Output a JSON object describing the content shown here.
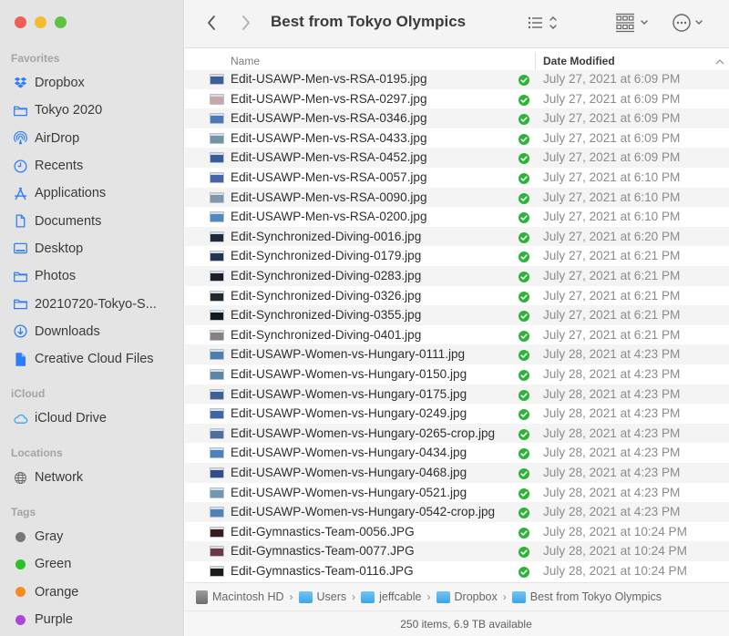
{
  "window": {
    "title": "Best from Tokyo Olympics"
  },
  "sidebar": {
    "sections": [
      {
        "heading": "Favorites",
        "items": [
          {
            "label": "Dropbox",
            "icon": "dropbox-icon"
          },
          {
            "label": "Tokyo 2020",
            "icon": "folder-icon"
          },
          {
            "label": "AirDrop",
            "icon": "airdrop-icon"
          },
          {
            "label": "Recents",
            "icon": "clock-icon"
          },
          {
            "label": "Applications",
            "icon": "applications-icon"
          },
          {
            "label": "Documents",
            "icon": "document-icon"
          },
          {
            "label": "Desktop",
            "icon": "desktop-icon"
          },
          {
            "label": "Photos",
            "icon": "folder-icon"
          },
          {
            "label": "20210720-Tokyo-S...",
            "icon": "folder-icon"
          },
          {
            "label": "Downloads",
            "icon": "download-icon"
          },
          {
            "label": "Creative Cloud Files",
            "icon": "file-filled-icon"
          }
        ]
      },
      {
        "heading": "iCloud",
        "items": [
          {
            "label": "iCloud Drive",
            "icon": "cloud-icon"
          }
        ]
      },
      {
        "heading": "Locations",
        "items": [
          {
            "label": "Network",
            "icon": "globe-icon"
          }
        ]
      },
      {
        "heading": "Tags",
        "items": [
          {
            "label": "Gray",
            "color": "#77767b"
          },
          {
            "label": "Green",
            "color": "#2cc12c"
          },
          {
            "label": "Orange",
            "color": "#f98a1d"
          },
          {
            "label": "Purple",
            "color": "#ad46d6"
          }
        ]
      }
    ]
  },
  "columns": {
    "name": "Name",
    "date_modified": "Date Modified",
    "sort": "ascending"
  },
  "files": [
    {
      "name": "Edit-USAWP-Men-vs-RSA-0195.jpg",
      "date": "July 27, 2021 at 6:09 PM",
      "thumb": "#3d5f95"
    },
    {
      "name": "Edit-USAWP-Men-vs-RSA-0297.jpg",
      "date": "July 27, 2021 at 6:09 PM",
      "thumb": "#c7a7a8"
    },
    {
      "name": "Edit-USAWP-Men-vs-RSA-0346.jpg",
      "date": "July 27, 2021 at 6:09 PM",
      "thumb": "#4a78b8"
    },
    {
      "name": "Edit-USAWP-Men-vs-RSA-0433.jpg",
      "date": "July 27, 2021 at 6:09 PM",
      "thumb": "#6f95a8"
    },
    {
      "name": "Edit-USAWP-Men-vs-RSA-0452.jpg",
      "date": "July 27, 2021 at 6:09 PM",
      "thumb": "#355d9e"
    },
    {
      "name": "Edit-USAWP-Men-vs-RSA-0057.jpg",
      "date": "July 27, 2021 at 6:10 PM",
      "thumb": "#4466a8"
    },
    {
      "name": "Edit-USAWP-Men-vs-RSA-0090.jpg",
      "date": "July 27, 2021 at 6:10 PM",
      "thumb": "#7d99a8"
    },
    {
      "name": "Edit-USAWP-Men-vs-RSA-0200.jpg",
      "date": "July 27, 2021 at 6:10 PM",
      "thumb": "#5187c2"
    },
    {
      "name": "Edit-Synchronized-Diving-0016.jpg",
      "date": "July 27, 2021 at 6:20 PM",
      "thumb": "#1b2a3a"
    },
    {
      "name": "Edit-Synchronized-Diving-0179.jpg",
      "date": "July 27, 2021 at 6:21 PM",
      "thumb": "#233450"
    },
    {
      "name": "Edit-Synchronized-Diving-0283.jpg",
      "date": "July 27, 2021 at 6:21 PM",
      "thumb": "#1a1f28"
    },
    {
      "name": "Edit-Synchronized-Diving-0326.jpg",
      "date": "July 27, 2021 at 6:21 PM",
      "thumb": "#22262e"
    },
    {
      "name": "Edit-Synchronized-Diving-0355.jpg",
      "date": "July 27, 2021 at 6:21 PM",
      "thumb": "#15181d"
    },
    {
      "name": "Edit-Synchronized-Diving-0401.jpg",
      "date": "July 27, 2021 at 6:21 PM",
      "thumb": "#8a7f84"
    },
    {
      "name": "Edit-USAWP-Women-vs-Hungary-0111.jpg",
      "date": "July 28, 2021 at 4:23 PM",
      "thumb": "#4c7fae"
    },
    {
      "name": "Edit-USAWP-Women-vs-Hungary-0150.jpg",
      "date": "July 28, 2021 at 4:23 PM",
      "thumb": "#5a86a9"
    },
    {
      "name": "Edit-USAWP-Women-vs-Hungary-0175.jpg",
      "date": "July 28, 2021 at 4:23 PM",
      "thumb": "#3f5f98"
    },
    {
      "name": "Edit-USAWP-Women-vs-Hungary-0249.jpg",
      "date": "July 28, 2021 at 4:23 PM",
      "thumb": "#3e66a3"
    },
    {
      "name": "Edit-USAWP-Women-vs-Hungary-0265-crop.jpg",
      "date": "July 28, 2021 at 4:23 PM",
      "thumb": "#4f6ea0"
    },
    {
      "name": "Edit-USAWP-Women-vs-Hungary-0434.jpg",
      "date": "July 28, 2021 at 4:23 PM",
      "thumb": "#4c82c0"
    },
    {
      "name": "Edit-USAWP-Women-vs-Hungary-0468.jpg",
      "date": "July 28, 2021 at 4:23 PM",
      "thumb": "#2f4f86"
    },
    {
      "name": "Edit-USAWP-Women-vs-Hungary-0521.jpg",
      "date": "July 28, 2021 at 4:23 PM",
      "thumb": "#6f98b3"
    },
    {
      "name": "Edit-USAWP-Women-vs-Hungary-0542-crop.jpg",
      "date": "July 28, 2021 at 4:23 PM",
      "thumb": "#4d82bb"
    },
    {
      "name": "Edit-Gymnastics-Team-0056.JPG",
      "date": "July 28, 2021 at 10:24 PM",
      "thumb": "#3a1c1c"
    },
    {
      "name": "Edit-Gymnastics-Team-0077.JPG",
      "date": "July 28, 2021 at 10:24 PM",
      "thumb": "#6b3a44"
    },
    {
      "name": "Edit-Gymnastics-Team-0116.JPG",
      "date": "July 28, 2021 at 10:24 PM",
      "thumb": "#1d1a1c"
    }
  ],
  "path_bar": [
    {
      "label": "Macintosh HD",
      "icon": "hard-drive-icon"
    },
    {
      "label": "Users",
      "icon": "folder-icon"
    },
    {
      "label": "jeffcable",
      "icon": "home-folder-icon"
    },
    {
      "label": "Dropbox",
      "icon": "folder-icon"
    },
    {
      "label": "Best from Tokyo Olympics",
      "icon": "folder-icon"
    }
  ],
  "status": "250 items, 6.9 TB available",
  "colors": {
    "accent": "#2f7df6",
    "sync_ok": "#2db33a"
  }
}
